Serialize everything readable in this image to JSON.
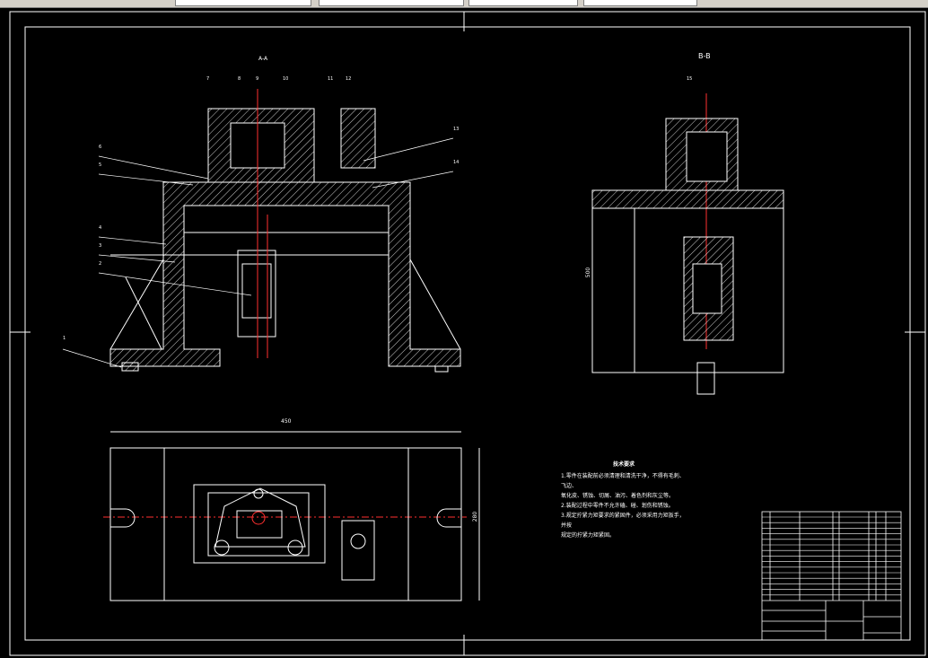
{
  "views": {
    "section_a": "A-A",
    "section_b": "B-B"
  },
  "dimensions": {
    "width_bottom": "450",
    "height_right": "280",
    "height_b": "500"
  },
  "notes": {
    "title": "技术要求",
    "lines": [
      "1.零件在装配前必须清理和清洗干净，不得有毛刺、飞边、",
      "氧化皮、锈蚀、切屑、油污、着色剂和灰尘等。",
      "2.装配过程中零件不允许磕、碰、划伤和锈蚀。",
      "3.规定拧紧力矩要求的紧固件，必须采用力矩扳手，并按",
      "规定的拧紧力矩紧固。"
    ]
  },
  "balloons": [
    "1",
    "2",
    "3",
    "4",
    "5",
    "6",
    "7",
    "8",
    "9",
    "10",
    "11",
    "12",
    "13",
    "14",
    "15"
  ],
  "colors": {
    "background": "#000000",
    "lines": "#ffffff",
    "center": "#ff3030",
    "toolbar": "#d4d0c8"
  }
}
